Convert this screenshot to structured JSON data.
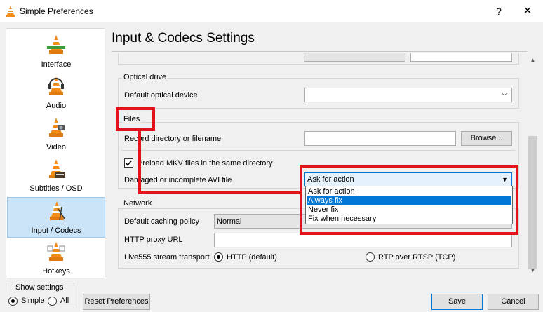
{
  "window": {
    "title": "Simple Preferences",
    "help_glyph": "?",
    "close_glyph": "✕"
  },
  "sidebar": {
    "items": [
      {
        "label": "Interface"
      },
      {
        "label": "Audio"
      },
      {
        "label": "Video"
      },
      {
        "label": "Subtitles / OSD"
      },
      {
        "label": "Input / Codecs",
        "selected": true
      },
      {
        "label": "Hotkeys"
      }
    ]
  },
  "page_title": "Input & Codecs Settings",
  "optical_drive": {
    "group_title": "Optical drive",
    "device_label": "Default optical device",
    "device_value": ""
  },
  "files": {
    "group_title": "Files",
    "record_label": "Record directory or filename",
    "record_value": "",
    "browse_label": "Browse...",
    "preload_label": "Preload MKV files in the same directory",
    "preload_checked": true,
    "avi_label": "Damaged or incomplete AVI file",
    "avi_selected": "Ask for action",
    "avi_options": [
      "Ask for action",
      "Always fix",
      "Never fix",
      "Fix when necessary"
    ],
    "avi_highlighted": "Always fix"
  },
  "network": {
    "group_title": "Network",
    "caching_label": "Default caching policy",
    "caching_value": "Normal",
    "proxy_label": "HTTP proxy URL",
    "proxy_value": "",
    "transport_label": "Live555 stream transport",
    "transport_options": [
      "HTTP (default)",
      "RTP over RTSP (TCP)"
    ],
    "transport_selected": "HTTP (default)"
  },
  "bottom": {
    "show_settings_title": "Show settings",
    "simple_label": "Simple",
    "all_label": "All",
    "show_selected": "Simple",
    "reset_label": "Reset Preferences",
    "save_label": "Save",
    "cancel_label": "Cancel"
  },
  "colors": {
    "annotation_red": "#e2131c",
    "selection_blue": "#0078d7",
    "sidebar_selected": "#cce4f7",
    "cone_orange": "#f28c1a"
  },
  "icons": {
    "app": "vlc-cone-icon",
    "sidebar": [
      "interface-cone-icon",
      "audio-cone-icon",
      "video-cone-icon",
      "subtitles-cone-icon",
      "input-codecs-cone-icon",
      "hotkeys-cone-icon"
    ]
  }
}
